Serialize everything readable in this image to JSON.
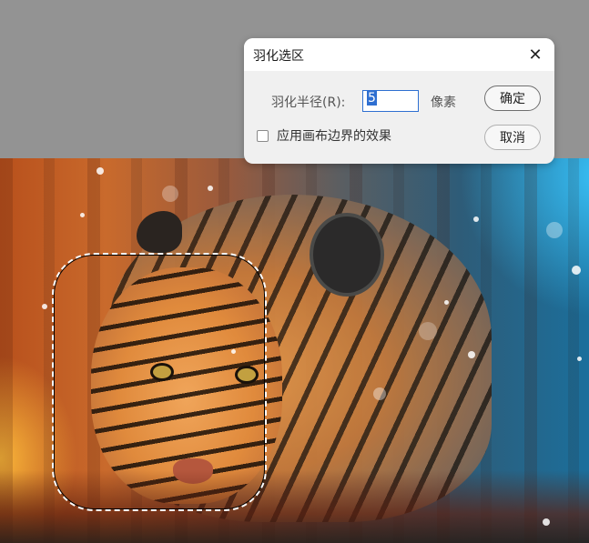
{
  "dialog": {
    "title": "羽化选区",
    "close_icon": "close-icon",
    "radius_label": "羽化半径(R):",
    "radius_value": "5",
    "unit_label": "像素",
    "ok_label": "确定",
    "cancel_label": "取消",
    "checkbox_label": "应用画布边界的效果",
    "checkbox_checked": false
  },
  "colors": {
    "workspace_bg": "#939393",
    "dialog_bg": "#f0f0f0",
    "input_focus": "#2e6fd1"
  }
}
